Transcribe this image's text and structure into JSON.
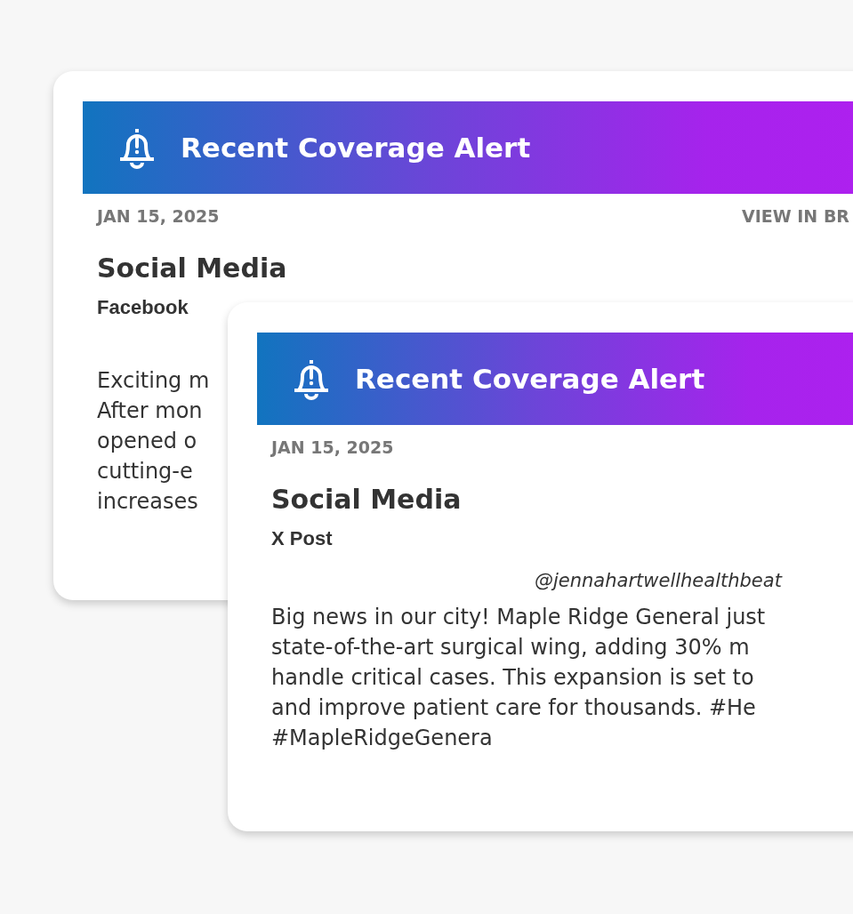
{
  "cards": [
    {
      "header": {
        "title": "Recent Coverage Alert"
      },
      "date": "JAN 15, 2025",
      "view_link": "VIEW IN BR",
      "category": "Social Media",
      "platform": "Facebook",
      "body_lines": [
        "Exciting m",
        "After mon",
        "opened o",
        "cutting-e",
        "increases"
      ]
    },
    {
      "header": {
        "title": "Recent Coverage Alert"
      },
      "date": "JAN 15, 2025",
      "category": "Social Media",
      "platform": "X Post",
      "handle": "@jennahartwellhealthbeat",
      "body_lines": [
        "Big news in our city! Maple Ridge General just",
        "state-of-the-art surgical wing, adding 30% m",
        "handle critical cases. This expansion is set to",
        "and improve patient care for thousands. #He",
        "#MapleRidgeGenera"
      ]
    }
  ]
}
